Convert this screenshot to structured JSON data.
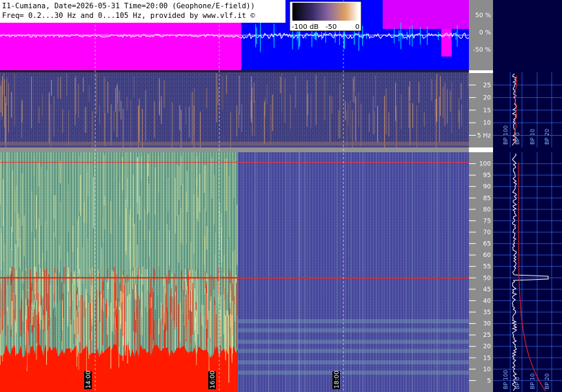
{
  "header": {
    "line1": "I1-Cumiana, Date=2026-05-31 Time=20:00 (Geophone/E-field))",
    "line2": "Freq= 0.2...30 Hz and 0...105 Hz, provided by www.vlf.it ©"
  },
  "colorbar": {
    "labels": [
      "-100 dB",
      "-50",
      "0"
    ],
    "stops": [
      "#000000",
      "#3a2a6a",
      "#8a6aa0",
      "#e0a060",
      "#ffffff"
    ]
  },
  "waveform": {
    "percent_labels": [
      "50 %",
      "0 %",
      "-50 %"
    ],
    "colors": {
      "left_bg": "#ff00ff",
      "right_bg": "#0000ff",
      "trace": "#ffffff",
      "trace_right": "#00e0ff"
    }
  },
  "chart_data": [
    {
      "type": "heatmap",
      "name": "spectrogram-0.2-30Hz",
      "title": "",
      "xlabel": "",
      "ylabel": "",
      "yticks": [
        5,
        10,
        15,
        20,
        25
      ],
      "ytick_labels": [
        "5 Hz",
        "10",
        "15",
        "20",
        "25"
      ],
      "ylim": [
        0.2,
        30
      ],
      "xticks": [
        "14:00",
        "16:00",
        "18:00"
      ],
      "colors": {
        "bg": "#3a3a7a",
        "streak": "#e0a060"
      }
    },
    {
      "type": "heatmap",
      "name": "spectrogram-0-105Hz",
      "title": "",
      "xlabel": "",
      "ylabel": "",
      "yticks": [
        5,
        10,
        15,
        20,
        25,
        30,
        35,
        40,
        45,
        50,
        55,
        60,
        65,
        70,
        75,
        80,
        85,
        90,
        95,
        100
      ],
      "ylim": [
        0,
        105
      ],
      "xticks": [
        "14:00",
        "16:00",
        "18:00"
      ],
      "mains_line_hz": 50,
      "marker_line_hz": 100,
      "colors": {
        "left_bg": "#5e9a82",
        "right_bg": "#48489a",
        "hot": "#ff1a00",
        "warm": "#f0f0a0"
      }
    },
    {
      "type": "line",
      "name": "spectrum-profile-upper",
      "bp_labels": [
        "BP 100",
        "BP 0",
        "BP 10",
        "BP 20"
      ]
    },
    {
      "type": "line",
      "name": "spectrum-profile-lower",
      "bp_labels": [
        "BP 100",
        "BP 0",
        "BP 10",
        "BP 20"
      ],
      "peak_hz": 50
    }
  ],
  "time_axis": {
    "labels": [
      "14:00",
      "16:00",
      "18:00"
    ]
  }
}
